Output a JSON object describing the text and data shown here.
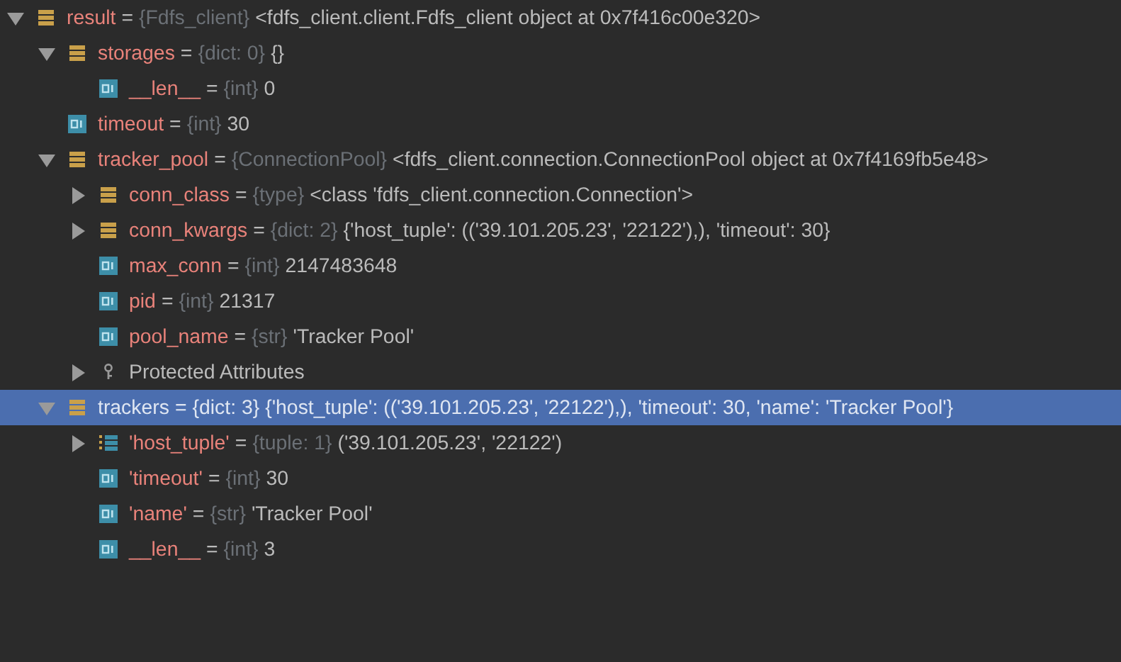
{
  "tree": [
    {
      "kind": "object",
      "name": "result",
      "sep": "=",
      "type": "{Fdfs_client}",
      "value": "<fdfs_client.client.Fdfs_client object at 0x7f416c00e320>",
      "expanded": true,
      "selected": false,
      "children": [
        {
          "kind": "object",
          "name": "storages",
          "sep": "=",
          "type": "{dict: 0}",
          "value": "{}",
          "expanded": true,
          "selected": false,
          "children": [
            {
              "kind": "int",
              "name": "__len__",
              "sep": "=",
              "type": "{int}",
              "value": "0",
              "selected": false
            }
          ]
        },
        {
          "kind": "int",
          "name": "timeout",
          "sep": "=",
          "type": "{int}",
          "value": "30",
          "selected": false
        },
        {
          "kind": "object",
          "name": "tracker_pool",
          "sep": "=",
          "type": "{ConnectionPool}",
          "value": "<fdfs_client.connection.ConnectionPool object at 0x7f4169fb5e48>",
          "expanded": true,
          "selected": false,
          "children": [
            {
              "kind": "object",
              "name": "conn_class",
              "sep": "=",
              "type": "{type}",
              "value": "<class 'fdfs_client.connection.Connection'>",
              "expanded": false,
              "selected": false
            },
            {
              "kind": "object",
              "name": "conn_kwargs",
              "sep": "=",
              "type": "{dict: 2}",
              "value": "{'host_tuple': (('39.101.205.23', '22122'),), 'timeout': 30}",
              "expanded": false,
              "selected": false
            },
            {
              "kind": "int",
              "name": "max_conn",
              "sep": "=",
              "type": "{int}",
              "value": "2147483648",
              "selected": false
            },
            {
              "kind": "int",
              "name": "pid",
              "sep": "=",
              "type": "{int}",
              "value": "21317",
              "selected": false
            },
            {
              "kind": "int",
              "name": "pool_name",
              "sep": "=",
              "type": "{str}",
              "value": "'Tracker Pool'",
              "selected": false
            },
            {
              "kind": "protected",
              "value": "Protected Attributes",
              "expanded": false,
              "selected": false
            }
          ]
        },
        {
          "kind": "object",
          "name": "trackers",
          "sep": "=",
          "type": "{dict: 3}",
          "value": "{'host_tuple': (('39.101.205.23', '22122'),), 'timeout': 30, 'name': 'Tracker Pool'}",
          "expanded": true,
          "selected": true,
          "children": [
            {
              "kind": "tuple",
              "name": "'host_tuple'",
              "sep": "=",
              "type": "{tuple: 1}",
              "value": "('39.101.205.23', '22122')",
              "expanded": false,
              "selected": false
            },
            {
              "kind": "int",
              "name": "'timeout'",
              "sep": "=",
              "type": "{int}",
              "value": "30",
              "selected": false
            },
            {
              "kind": "int",
              "name": "'name'",
              "sep": "=",
              "type": "{str}",
              "value": "'Tracker Pool'",
              "selected": false
            },
            {
              "kind": "int",
              "name": "__len__",
              "sep": "=",
              "type": "{int}",
              "value": "3",
              "selected": false
            }
          ]
        }
      ]
    }
  ]
}
